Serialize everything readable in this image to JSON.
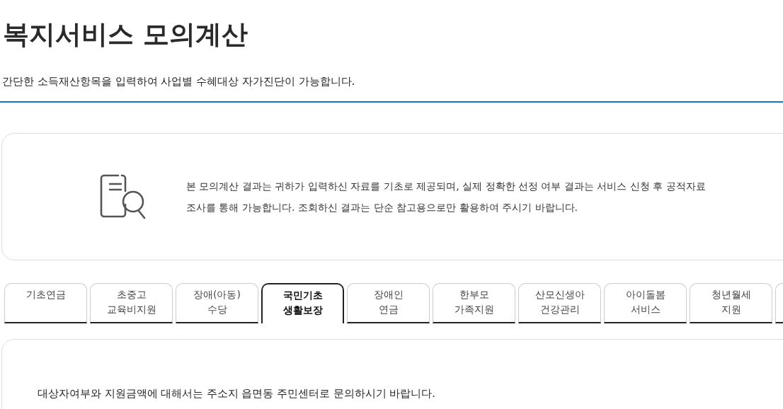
{
  "title": "복지서비스 모의계산",
  "subtitle": "간단한 소득재산항목을 입력하여 사업별 수혜대상 자가진단이 가능합니다.",
  "notice": {
    "lines": [
      "본 모의계산 결과는 귀하가 입력하신 자료를 기초로 제공되며, 실제 정확한 선정 여부 결과는 서비스 신청 후 공적자료",
      "조사를 통해 가능합니다. 조회하신 결과는 단순 참고용으로만 활용하여 주시기 바랍니다."
    ]
  },
  "tabs": [
    {
      "lines": [
        "기초연금"
      ],
      "selected": false
    },
    {
      "lines": [
        "초중고",
        "교육비지원"
      ],
      "selected": false
    },
    {
      "lines": [
        "장애(아동)",
        "수당"
      ],
      "selected": false
    },
    {
      "lines": [
        "국민기초",
        "생활보장"
      ],
      "selected": true
    },
    {
      "lines": [
        "장애인",
        "연금"
      ],
      "selected": false
    },
    {
      "lines": [
        "한부모",
        "가족지원"
      ],
      "selected": false
    },
    {
      "lines": [
        "산모신생아",
        "건강관리"
      ],
      "selected": false
    },
    {
      "lines": [
        "아이돌봄",
        "서비스"
      ],
      "selected": false
    },
    {
      "lines": [
        "청년월세",
        "지원"
      ],
      "selected": false
    }
  ],
  "content": {
    "text": "대상자여부와 지원금액에 대해서는 주소지 읍면동 주민센터로 문의하시기 바랍니다."
  }
}
